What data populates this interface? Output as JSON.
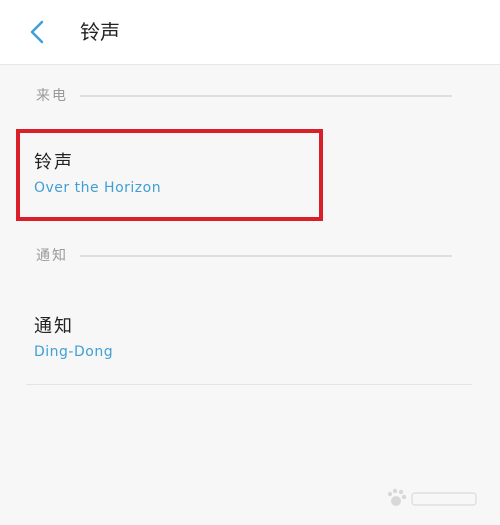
{
  "header": {
    "title": "铃声",
    "back_icon": "chevron-left-icon"
  },
  "sections": [
    {
      "label": "来电",
      "item": {
        "title": "铃声",
        "value": "Over the Horizon"
      }
    },
    {
      "label": "通知",
      "item": {
        "title": "通知",
        "value": "Ding-Dong"
      }
    }
  ],
  "colors": {
    "accent": "#3f9fd6",
    "highlight": "#d81f2a",
    "background": "#f7f7f7"
  },
  "watermark": {
    "icon": "baidu-paw-icon"
  }
}
